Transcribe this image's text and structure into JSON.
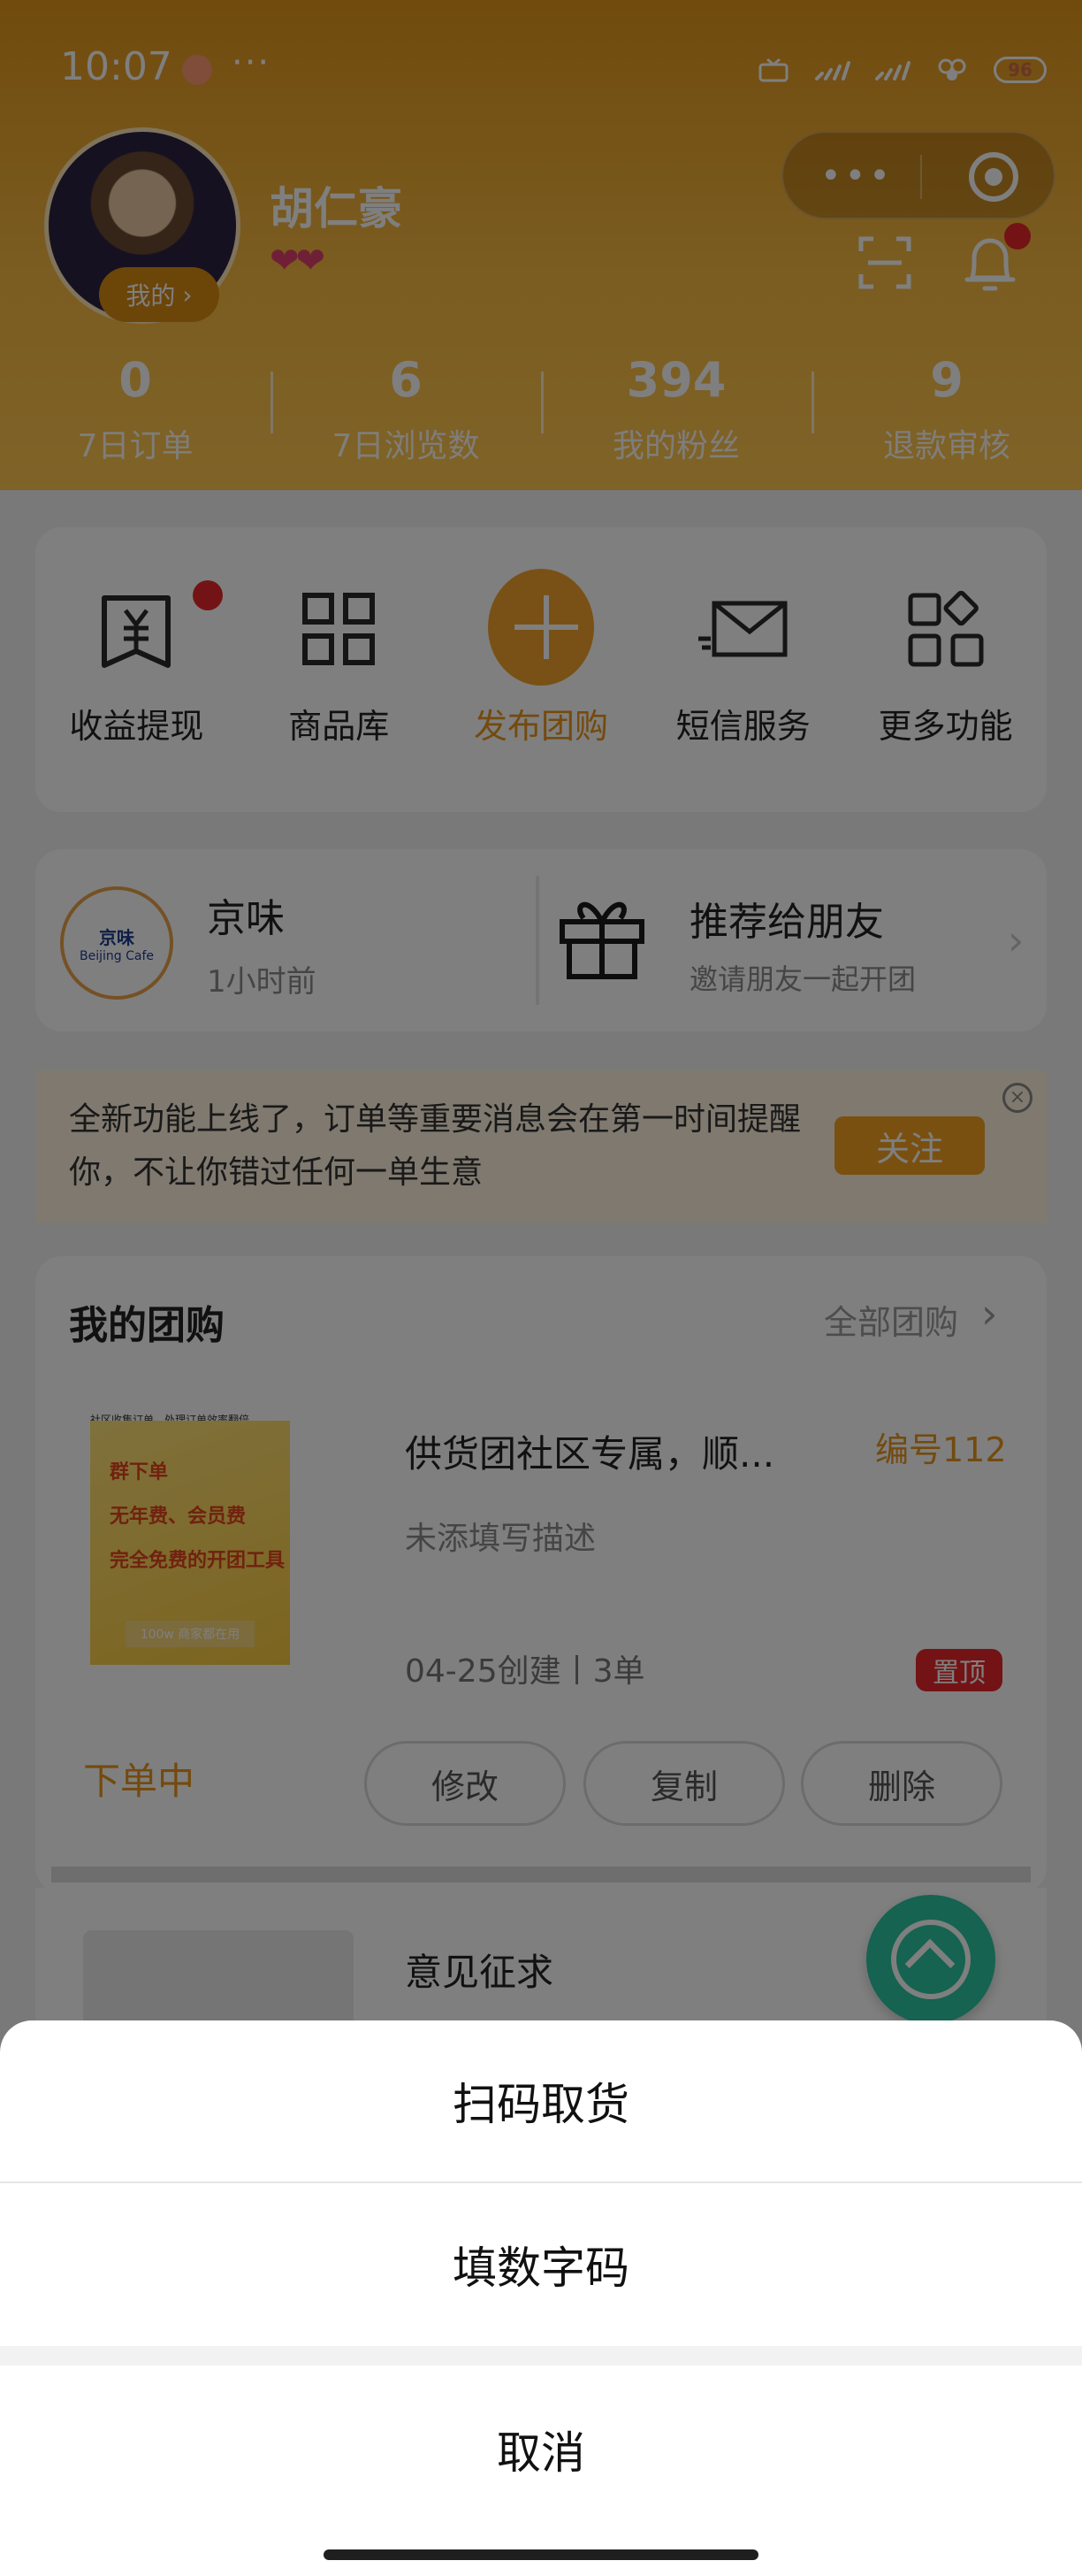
{
  "status_bar": {
    "time": "10:07",
    "more": "···",
    "battery": "96"
  },
  "profile": {
    "name": "胡仁豪",
    "hearts": "❤❤",
    "badge_label": "我的",
    "badge_arrow": "›"
  },
  "capsule": {
    "dots": "•••"
  },
  "stats": [
    {
      "value": "0",
      "label": "7日订单"
    },
    {
      "value": "6",
      "label": "7日浏览数"
    },
    {
      "value": "394",
      "label": "我的粉丝"
    },
    {
      "value": "9",
      "label": "退款审核"
    }
  ],
  "functions": [
    {
      "label": "收益提现",
      "icon": "wallet-yen-icon"
    },
    {
      "label": "商品库",
      "icon": "grid-icon"
    },
    {
      "label": "发布团购",
      "icon": "plus-icon"
    },
    {
      "label": "短信服务",
      "icon": "envelope-icon"
    },
    {
      "label": "更多功能",
      "icon": "apps-icon"
    }
  ],
  "shop": {
    "name": "京味",
    "logo_title": "京味",
    "logo_sub": "Beijing Cafe",
    "time": "1小时前",
    "recommend_title": "推荐给朋友",
    "recommend_sub": "邀请朋友一起开团",
    "arrow": "›"
  },
  "notice": {
    "text": "全新功能上线了，订单等重要消息会在第一时间提醒你，不让你错过任何一单生意",
    "follow_label": "关注",
    "close": "×"
  },
  "group_buy": {
    "title": "我的团购",
    "all_label": "全部团购",
    "all_arrow": "›",
    "product": {
      "name": "供货团社区专属，顺...",
      "id_label": "编号112",
      "desc": "未添填写描述",
      "meta": "04-25创建丨3单",
      "pin_label": "置顶",
      "img_top": "社区收集订单，处理订单效率翻倍",
      "img_line1": "群下单",
      "img_line2": "无年费、会员费",
      "img_line3": "完全免费的开团工具",
      "img_bottom": "100w 商家都在用"
    },
    "status": "下单中",
    "buttons": {
      "edit": "修改",
      "copy": "复制",
      "delete": "删除"
    }
  },
  "next_item": {
    "title": "意见征求"
  },
  "action_sheet": {
    "items": [
      "扫码取货",
      "填数字码"
    ],
    "cancel": "取消"
  },
  "colors": {
    "accent": "#f2a22c",
    "status_orange": "#e8951d",
    "badge_red": "#e8262b",
    "top_button": "#2bc7a0"
  }
}
